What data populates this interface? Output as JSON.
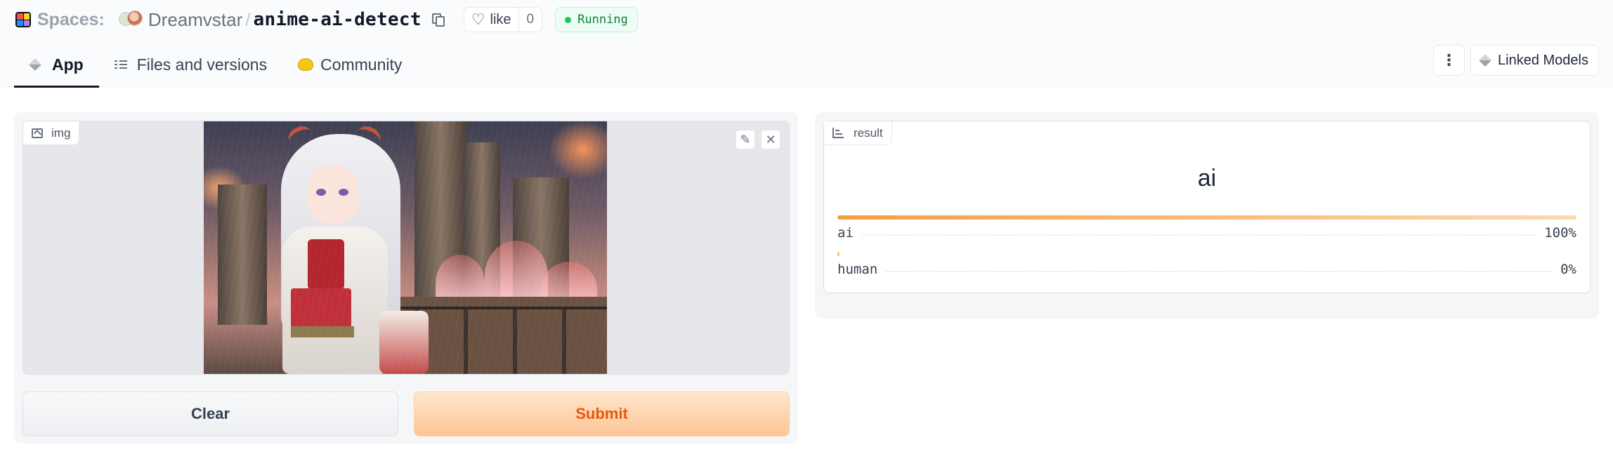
{
  "header": {
    "spaces_label": "Spaces:",
    "owner": "Dreamvstar",
    "separator": "/",
    "repo": "anime-ai-detect",
    "like_label": "like",
    "like_count": "0",
    "status": "Running",
    "colors": {
      "status": "#22c55e",
      "accent": "#f97316"
    }
  },
  "tabs": [
    {
      "label": "App",
      "icon": "cube-icon",
      "active": true
    },
    {
      "label": "Files and versions",
      "icon": "files-icon",
      "active": false
    },
    {
      "label": "Community",
      "icon": "community-icon",
      "active": false
    }
  ],
  "toolbar": {
    "more_icon": "kebab-icon",
    "linked_models_label": "Linked Models"
  },
  "input": {
    "label": "img",
    "edit_icon": "pencil-icon",
    "close_icon": "close-icon"
  },
  "buttons": {
    "clear": "Clear",
    "submit": "Submit"
  },
  "result": {
    "label": "result",
    "top_label": "ai",
    "confidences": [
      {
        "label": "ai",
        "value": "100%",
        "fraction": 1.0
      },
      {
        "label": "human",
        "value": "0%",
        "fraction": 0.0
      }
    ]
  }
}
